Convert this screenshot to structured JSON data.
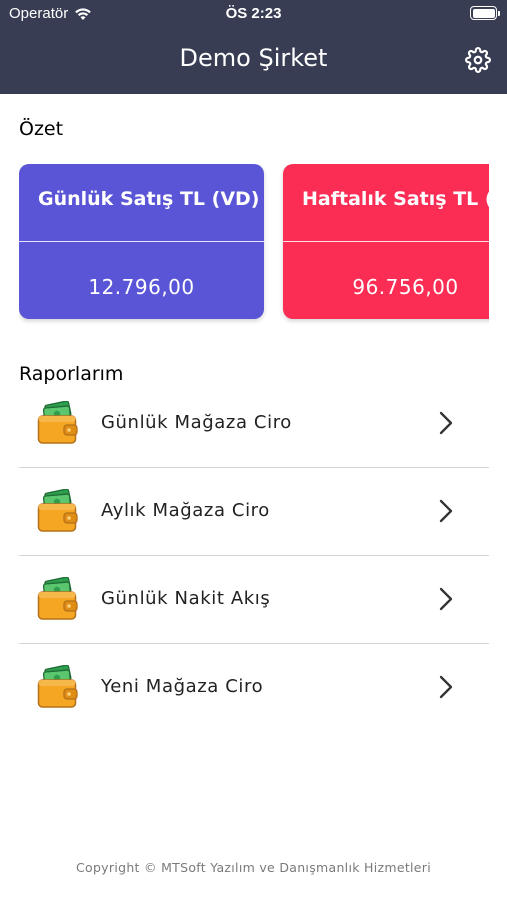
{
  "status_bar": {
    "carrier": "Operatör",
    "time": "ÖS 2:23",
    "icons": [
      "wifi-icon",
      "battery-icon"
    ]
  },
  "header": {
    "title": "Demo Şirket",
    "settings_icon": "gear-icon"
  },
  "summary": {
    "title": "Özet",
    "cards": [
      {
        "title": "Günlük Satış TL (VD)",
        "value": "12.796,00",
        "color": "#5a55d6"
      },
      {
        "title": "Haftalık Satış TL (VD)",
        "value": "96.756,00",
        "color": "#fb2d55"
      }
    ]
  },
  "reports": {
    "title": "Raporlarım",
    "items": [
      {
        "label": "Günlük Mağaza Ciro",
        "icon": "wallet-money-icon"
      },
      {
        "label": "Aylık Mağaza Ciro",
        "icon": "wallet-money-icon"
      },
      {
        "label": "Günlük Nakit Akış",
        "icon": "wallet-money-icon"
      },
      {
        "label": "Yeni Mağaza Ciro",
        "icon": "wallet-money-icon"
      }
    ]
  },
  "footer": {
    "copyright": "Copyright © MTSoft Yazılım ve Danışmanlık Hizmetleri"
  },
  "colors": {
    "navbar": "#383d54",
    "card_daily": "#5a55d6",
    "card_weekly": "#fb2d55"
  }
}
